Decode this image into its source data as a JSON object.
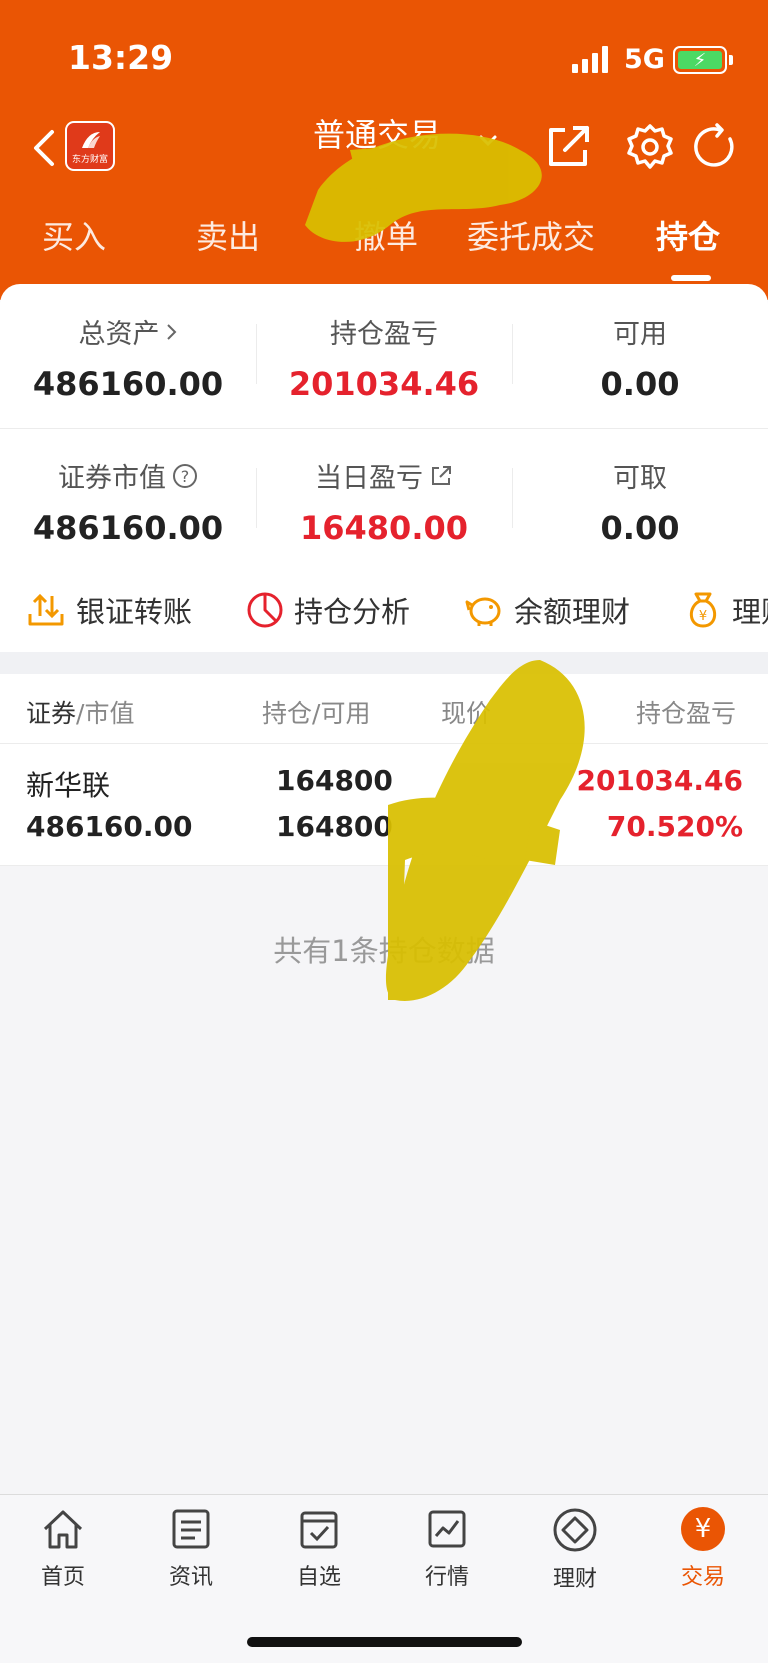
{
  "status_bar": {
    "time": "13:29",
    "network": "5G"
  },
  "header": {
    "logo_text": "东方财富",
    "title": "普通交易",
    "tabs": [
      {
        "label": "买入"
      },
      {
        "label": "卖出"
      },
      {
        "label": "撤单"
      },
      {
        "label": "委托成交"
      },
      {
        "label": "持仓",
        "active": true
      }
    ]
  },
  "summary": {
    "row1": [
      {
        "label": "总资产",
        "value": "486160.00"
      },
      {
        "label": "持仓盈亏",
        "value": "201034.46"
      },
      {
        "label": "可用",
        "value": "0.00"
      }
    ],
    "row2": [
      {
        "label": "证券市值",
        "value": "486160.00"
      },
      {
        "label": "当日盈亏",
        "value": "16480.00"
      },
      {
        "label": "可取",
        "value": "0.00"
      }
    ]
  },
  "quick_actions": [
    {
      "label": "银证转账",
      "icon": "transfer-icon"
    },
    {
      "label": "持仓分析",
      "icon": "pie-chart-icon"
    },
    {
      "label": "余额理财",
      "icon": "piggy-bank-icon"
    },
    {
      "label": "理财",
      "icon": "money-bag-icon"
    }
  ],
  "table": {
    "headers": {
      "security": "证券",
      "market_value": "/市值",
      "position": "持仓",
      "available": "/可用",
      "price": "现价",
      "pnl": "持仓盈亏"
    },
    "rows": [
      {
        "name": "新华联",
        "market_value": "486160.00",
        "position": "164800",
        "available": "164800",
        "pnl": "201034.46",
        "pnl_pct": "70.520%"
      }
    ]
  },
  "empty_hint": "共有1条持仓数据",
  "tabbar": [
    {
      "label": "首页",
      "icon": "home-icon"
    },
    {
      "label": "资讯",
      "icon": "news-icon"
    },
    {
      "label": "自选",
      "icon": "watchlist-icon"
    },
    {
      "label": "行情",
      "icon": "market-icon"
    },
    {
      "label": "理财",
      "icon": "wealth-icon"
    },
    {
      "label": "交易",
      "icon": "yuan-icon",
      "active": true
    }
  ],
  "colors": {
    "brand": "#ea5504",
    "profit": "#e5222d",
    "scribble": "#d9bf00"
  }
}
